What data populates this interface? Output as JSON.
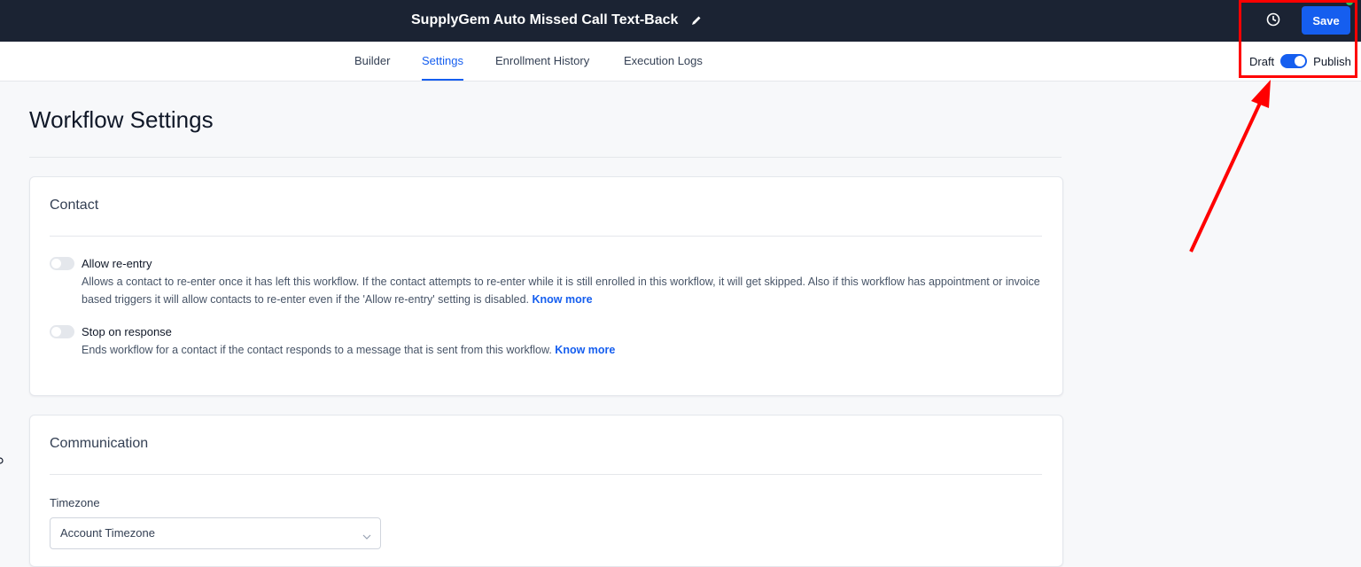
{
  "header": {
    "title": "SupplyGem Auto Missed Call Text-Back",
    "save_label": "Save"
  },
  "tabs": [
    {
      "label": "Builder",
      "active": false
    },
    {
      "label": "Settings",
      "active": true
    },
    {
      "label": "Enrollment History",
      "active": false
    },
    {
      "label": "Execution Logs",
      "active": false
    }
  ],
  "publish": {
    "draft_label": "Draft",
    "publish_label": "Publish",
    "published": true
  },
  "page": {
    "title": "Workflow Settings"
  },
  "contact": {
    "title": "Contact",
    "options": [
      {
        "label": "Allow re-entry",
        "enabled": false,
        "description": "Allows a contact to re-enter once it has left this workflow. If the contact attempts to re-enter while it is still enrolled in this workflow, it will get skipped. Also if this workflow has appointment or invoice based triggers it will allow contacts to re-enter even if the 'Allow re-entry' setting is disabled.",
        "link": "Know more"
      },
      {
        "label": "Stop on response",
        "enabled": false,
        "description": "Ends workflow for a contact if the contact responds to a message that is sent from this workflow.",
        "link": "Know more"
      }
    ]
  },
  "communication": {
    "title": "Communication",
    "timezone_label": "Timezone",
    "timezone_value": "Account Timezone"
  },
  "colors": {
    "accent": "#155eef",
    "topbar": "#1b2333",
    "annotation": "#ff0000"
  }
}
